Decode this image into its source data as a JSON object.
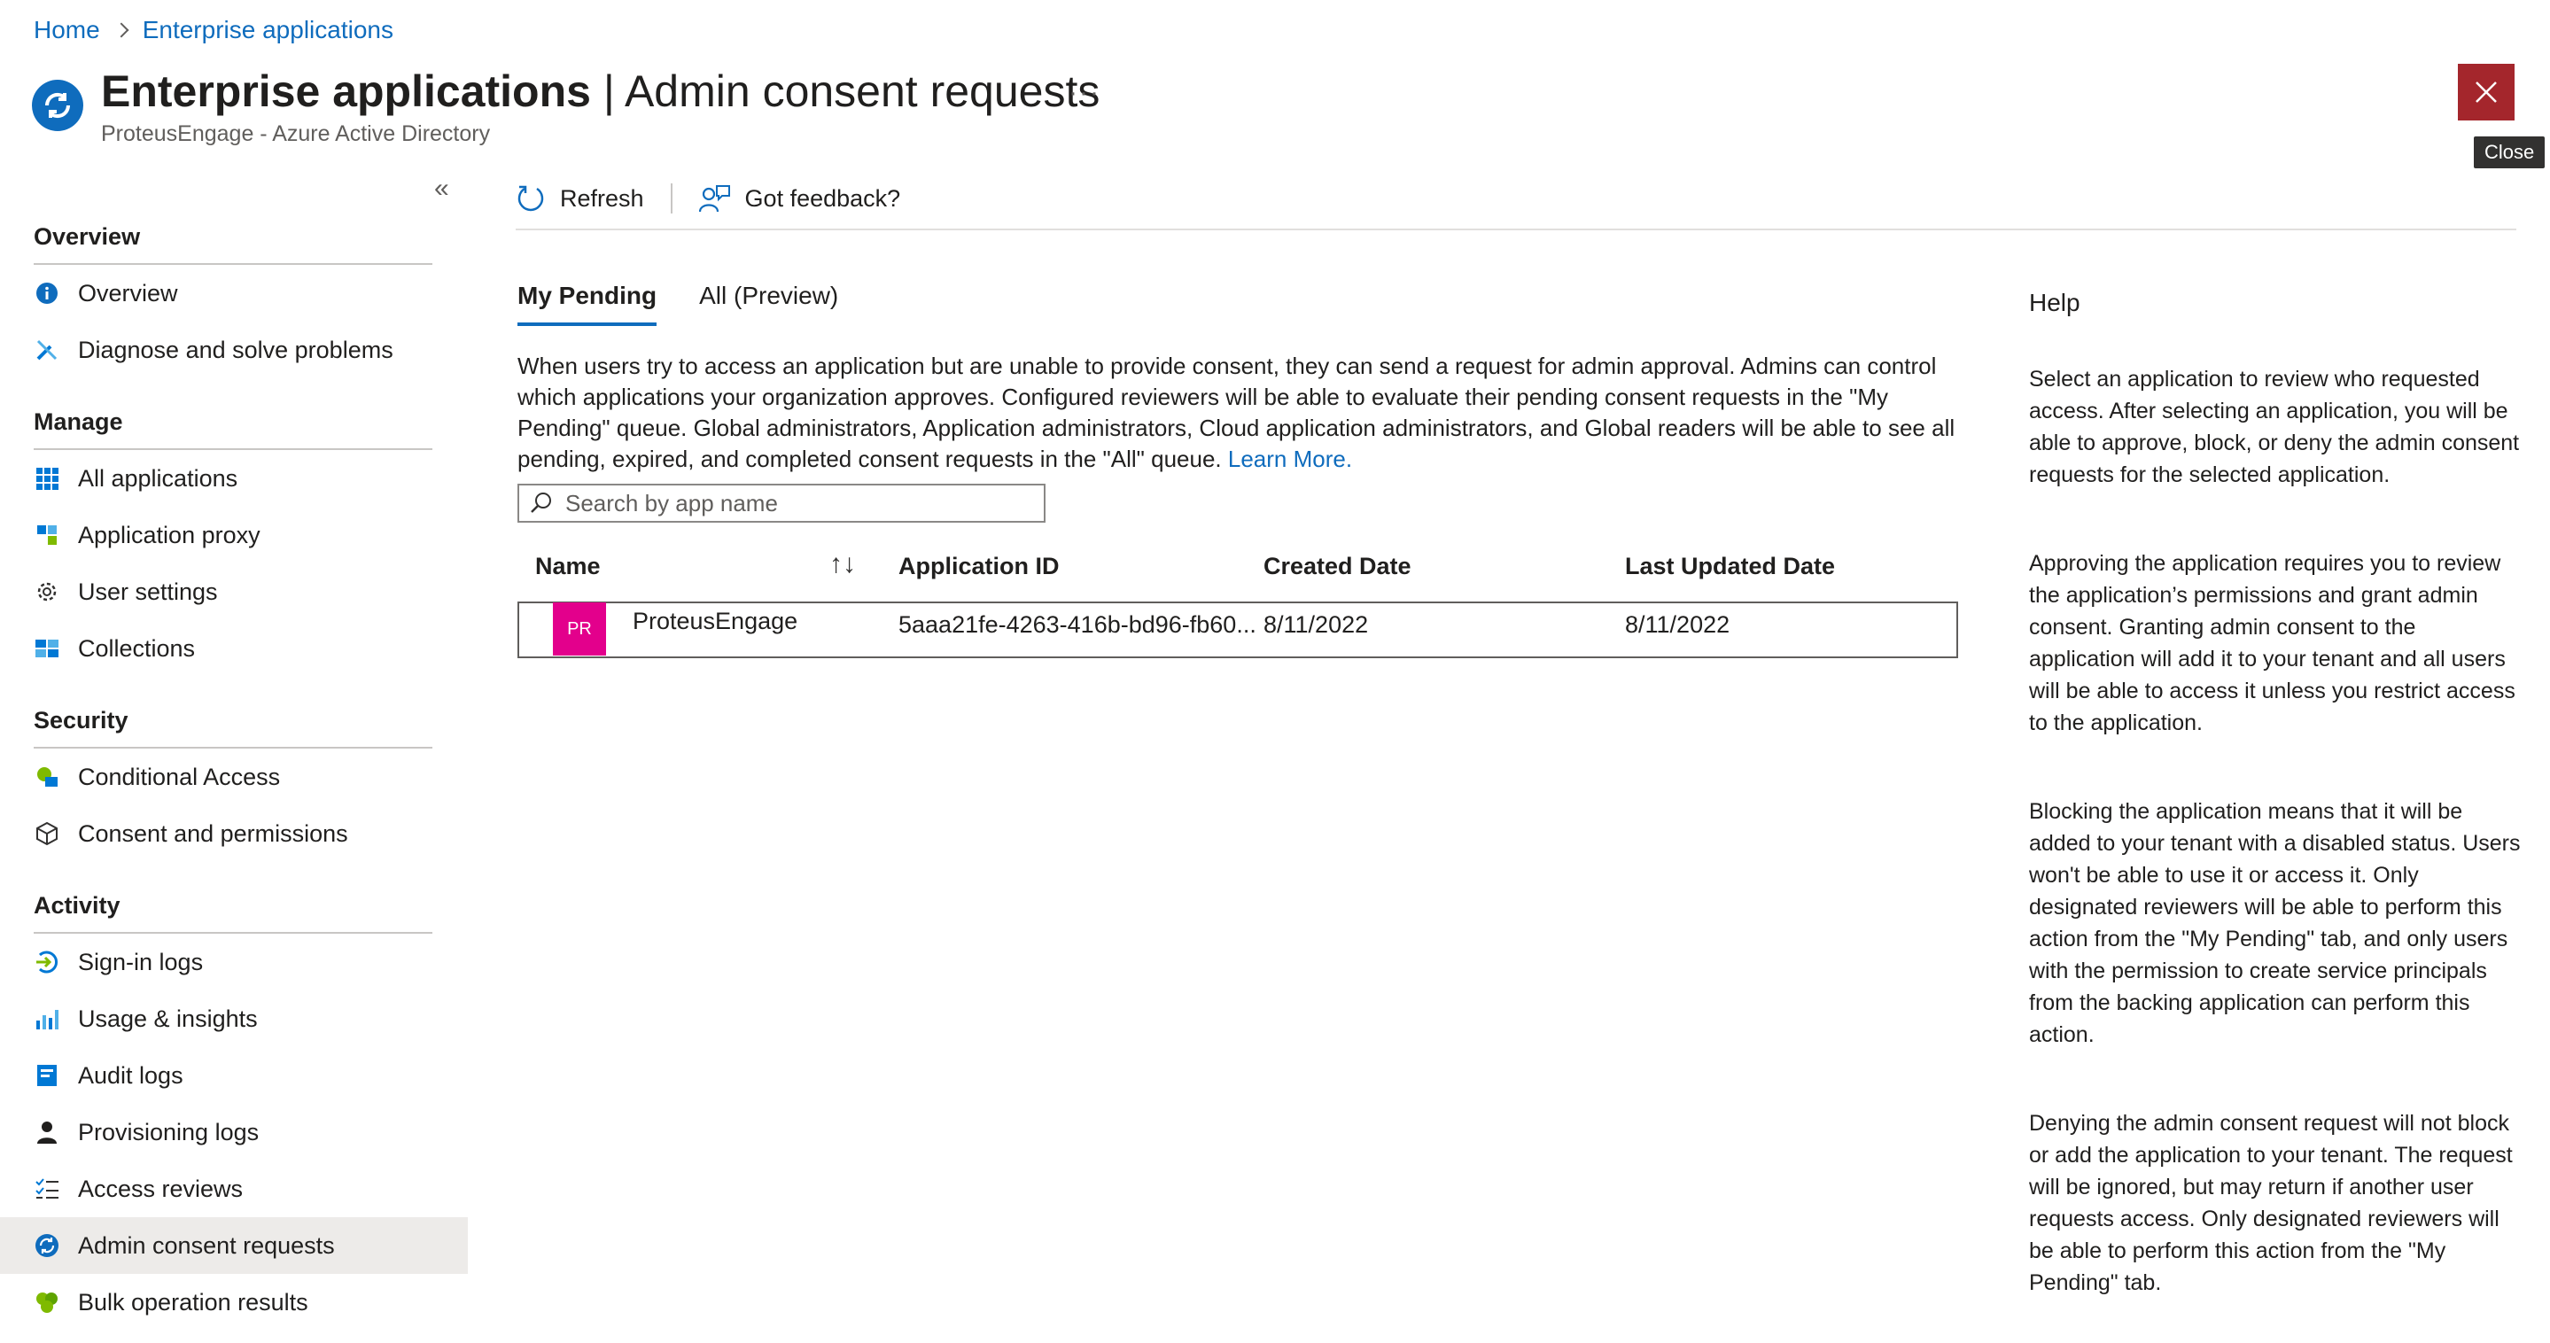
{
  "breadcrumb": {
    "home": "Home",
    "current": "Enterprise applications"
  },
  "header": {
    "title_bold": "Enterprise applications",
    "title_rest": " | Admin consent requests",
    "subtitle": "ProteusEngage - Azure Active Directory",
    "more": "···",
    "close_tooltip": "Close"
  },
  "sidebar": {
    "sections": [
      {
        "heading": "Overview",
        "items": [
          "Overview",
          "Diagnose and solve problems"
        ]
      },
      {
        "heading": "Manage",
        "items": [
          "All applications",
          "Application proxy",
          "User settings",
          "Collections"
        ]
      },
      {
        "heading": "Security",
        "items": [
          "Conditional Access",
          "Consent and permissions"
        ]
      },
      {
        "heading": "Activity",
        "items": [
          "Sign-in logs",
          "Usage & insights",
          "Audit logs",
          "Provisioning logs",
          "Access reviews",
          "Admin consent requests",
          "Bulk operation results"
        ]
      }
    ],
    "active": "Admin consent requests"
  },
  "toolbar": {
    "refresh": "Refresh",
    "feedback": "Got feedback?"
  },
  "tabs": {
    "my_pending": "My Pending",
    "all": "All (Preview)"
  },
  "description": "When users try to access an application but are unable to provide consent, they can send a request for admin approval. Admins can control which applications your organization approves. Configured reviewers will be able to evaluate their pending consent requests in the \"My Pending\" queue. Global administrators, Application administrators, Cloud application administrators, and Global readers will be able to see all pending, expired, and completed consent requests in the \"All\" queue.",
  "learn_more": "Learn More.",
  "search": {
    "placeholder": "Search by app name"
  },
  "table": {
    "columns": [
      "Name",
      "Application ID",
      "Created Date",
      "Last Updated Date"
    ],
    "rows": [
      {
        "initials": "PR",
        "name": "ProteusEngage",
        "app_id": "5aaa21fe-4263-416b-bd96-fb60...",
        "created": "8/11/2022",
        "updated": "8/11/2022"
      }
    ]
  },
  "help": {
    "heading": "Help",
    "paragraphs": [
      "Select an application to review who requested access. After selecting an application, you will be able to approve, block, or deny the admin consent requests for the selected application.",
      "Approving the application requires you to review the application’s permissions and grant admin consent. Granting admin consent to the application will add it to your tenant and all users will be able to access it unless you restrict access to the application.",
      "Blocking the application means that it will be added to your tenant with a disabled status. Users won't be able to use it or access it. Only designated reviewers will be able to perform this action from the \"My Pending\" tab, and only users with the permission to create service principals from the backing application can perform this action.",
      "Denying the admin consent request will not block or add the application to your tenant. The request will be ignored, but may return if another user requests access. Only designated reviewers will be able to perform this action from the \"My Pending\" tab."
    ]
  },
  "colors": {
    "accent": "#0f6cbd",
    "close": "#a4262c",
    "avatar": "#e3008c"
  }
}
